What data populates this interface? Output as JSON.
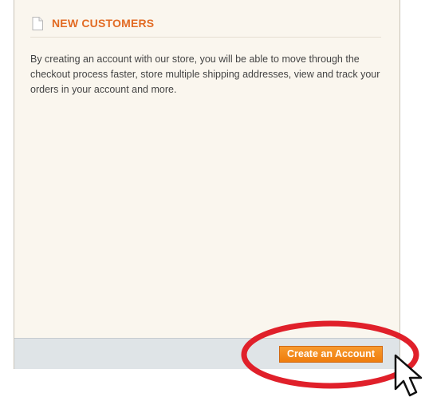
{
  "panel": {
    "title": "NEW CUSTOMERS",
    "icon": "document-icon",
    "description": "By creating an account with our store, you will be able to move through the checkout process faster, store multiple shipping addresses, view and track your orders in your account and more."
  },
  "actions": {
    "create_account_label": "Create an Account"
  },
  "annotation": {
    "highlight_color": "#e0202a",
    "cursor_icon": "arrow-cursor-icon"
  },
  "colors": {
    "title": "#e26b24",
    "button": "#f28a1f",
    "panel_background": "#faf6ee",
    "button_bar": "#dfe4e7"
  }
}
